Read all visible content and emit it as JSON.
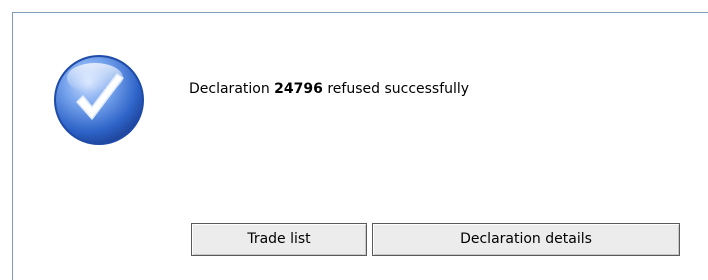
{
  "message": {
    "prefix": "Declaration ",
    "declaration_number": "24796",
    "suffix": " refused successfully"
  },
  "buttons": {
    "trade_list_label": "Trade list",
    "declaration_details_label": "Declaration details"
  },
  "icon": {
    "name": "checkmark-success-icon",
    "color": "#2e64c8"
  }
}
